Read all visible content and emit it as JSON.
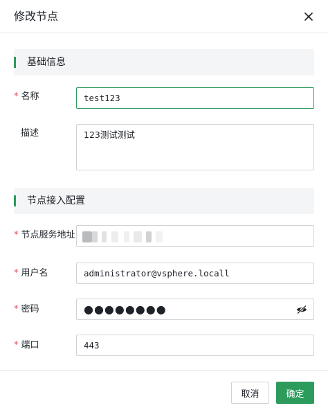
{
  "dialog": {
    "title": "修改节点",
    "close_icon": "close-icon"
  },
  "sections": {
    "basic": "基础信息",
    "access": "节点接入配置"
  },
  "fields": {
    "required_mark": "*",
    "name": {
      "label": "名称",
      "value": "test123"
    },
    "description": {
      "label": "描述",
      "value": "123测试测试"
    },
    "address": {
      "label": "节点服务地址",
      "value_redacted": true
    },
    "username": {
      "label": "用户名",
      "value": "administrator@vsphere.locall"
    },
    "password": {
      "label": "密码",
      "value": "●●●●●●●●",
      "toggle_icon": "eye-icon"
    },
    "port": {
      "label": "端口",
      "value": "443"
    }
  },
  "footer": {
    "cancel_label": "取消",
    "ok_label": "确定"
  },
  "colors": {
    "accent": "#2c9b5c",
    "required": "#e34d59"
  }
}
